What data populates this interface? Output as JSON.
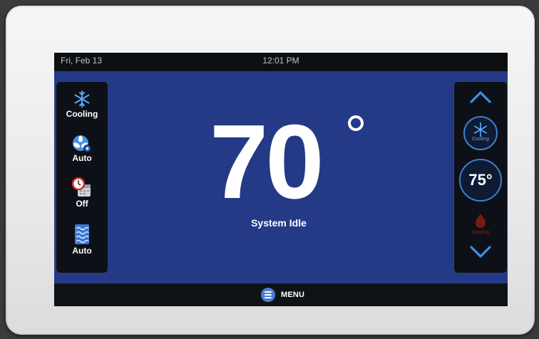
{
  "header": {
    "date": "Fri, Feb 13",
    "time": "12:01 PM"
  },
  "main": {
    "temperature": "70",
    "status": "System Idle"
  },
  "left_modes": [
    {
      "label": "Cooling",
      "icon": "snowflake-icon"
    },
    {
      "label": "Auto",
      "icon": "fan-icon"
    },
    {
      "label": "Off",
      "icon": "schedule-clock-icon"
    },
    {
      "label": "Auto",
      "icon": "humidity-waves-icon"
    }
  ],
  "right_panel": {
    "mode_label": "Cooling",
    "setpoint": "75°",
    "heat_label": "Heating",
    "up_icon": "chevron-up-icon",
    "down_icon": "chevron-down-icon"
  },
  "footer": {
    "menu_label": "MENU"
  },
  "colors": {
    "screen_blue": "#243a87",
    "accent": "#3a7fd0",
    "heat": "#8b2018"
  }
}
